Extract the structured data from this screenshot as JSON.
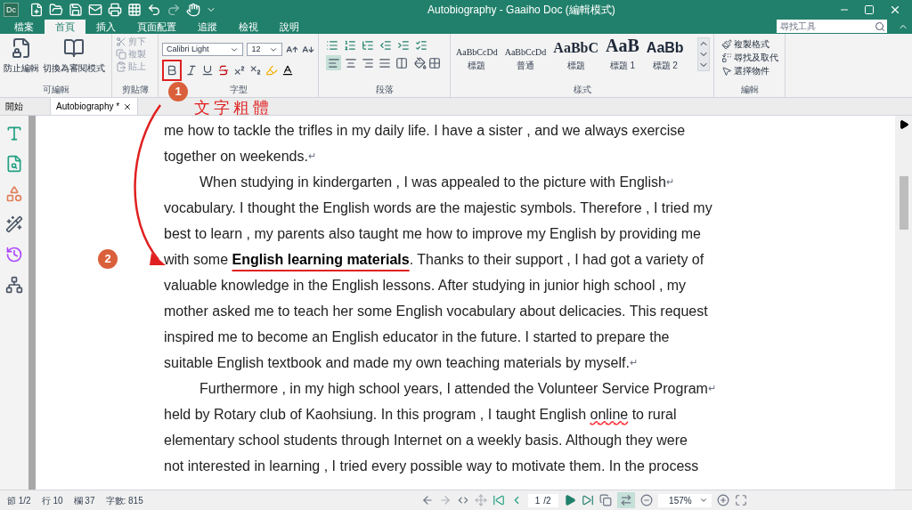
{
  "window": {
    "title": "Autobiography - Gaaiho Doc (編輯模式)",
    "logo": "Dc"
  },
  "search": {
    "placeholder": "尋找工具"
  },
  "menu_tabs": [
    {
      "label": "檔案",
      "selected": false
    },
    {
      "label": "首頁",
      "selected": true
    },
    {
      "label": "插入",
      "selected": false
    },
    {
      "label": "頁面配置",
      "selected": false
    },
    {
      "label": "追蹤",
      "selected": false
    },
    {
      "label": "檢視",
      "selected": false
    },
    {
      "label": "說明",
      "selected": false
    }
  ],
  "ribbon": {
    "protect": {
      "label": "可編輯",
      "buttons": [
        "防止編輯",
        "切換為審閱模式"
      ]
    },
    "clipboard": {
      "label": "剪貼簿",
      "items": [
        {
          "label": "剪下",
          "disabled": true
        },
        {
          "label": "複製",
          "disabled": true
        },
        {
          "label": "貼上",
          "disabled": true
        }
      ]
    },
    "font": {
      "label": "字型",
      "font_name": "Calibri Light",
      "font_size": "12",
      "bold_highlighted": true
    },
    "paragraph": {
      "label": "段落",
      "align": [
        {
          "kind": "left",
          "selected": true
        },
        {
          "kind": "center",
          "selected": false
        },
        {
          "kind": "right",
          "selected": false
        },
        {
          "kind": "justify",
          "selected": false
        },
        {
          "kind": "distributed",
          "selected": false
        }
      ]
    },
    "styles": {
      "label": "樣式",
      "items": [
        {
          "preview": "AaBbCcDd",
          "name": "標題"
        },
        {
          "preview": "AaBbCcDd",
          "name": "普通"
        },
        {
          "preview": "AaBbC",
          "name": "標題"
        },
        {
          "preview": "AaB",
          "name": "標題 1"
        },
        {
          "preview": "AaBb",
          "name": "標題 2"
        }
      ]
    },
    "editing": {
      "label": "編輯",
      "items": [
        "複製格式",
        "尋找及取代",
        "選擇物件"
      ]
    }
  },
  "doc_tabs": [
    {
      "label": "開始",
      "selected": false,
      "closable": false
    },
    {
      "label": "Autobiography *",
      "selected": true,
      "closable": true
    }
  ],
  "document": {
    "lines": [
      {
        "indent": false,
        "segments": [
          {
            "text": "me how to tackle the trifles in my daily life. I have a sister , and we always exercise"
          }
        ]
      },
      {
        "indent": false,
        "end_mark": "↵",
        "segments": [
          {
            "text": "together on weekends."
          }
        ]
      },
      {
        "indent": true,
        "end_mark": "↵",
        "segments": [
          {
            "text": "When studying in kindergarten , I was appealed to the picture with English"
          }
        ]
      },
      {
        "indent": false,
        "segments": [
          {
            "text": "vocabulary. I thought the English words are the majestic symbols. Therefore , I tried my"
          }
        ]
      },
      {
        "indent": false,
        "segments": [
          {
            "text": "best to learn , my parents also taught me how to improve my English by providing me"
          }
        ]
      },
      {
        "indent": false,
        "segments": [
          {
            "text": "with some "
          },
          {
            "text": "English learning materials",
            "kind": "bold"
          },
          {
            "text": ". Thanks to their support , I had got a variety of"
          }
        ]
      },
      {
        "indent": false,
        "segments": [
          {
            "text": "valuable knowledge in the English lessons. After studying in junior high school , my"
          }
        ]
      },
      {
        "indent": false,
        "segments": [
          {
            "text": "mother asked me to teach her some English vocabulary about delicacies. This request"
          }
        ]
      },
      {
        "indent": false,
        "segments": [
          {
            "text": "inspired me to become an English educator in the future. I started to prepare the"
          }
        ]
      },
      {
        "indent": false,
        "end_mark": "↵",
        "segments": [
          {
            "text": "suitable English textbook and made my own teaching materials by myself."
          }
        ]
      },
      {
        "indent": true,
        "end_mark": "↵",
        "segments": [
          {
            "text": "Furthermore , in my high school years, I attended the Volunteer Service Program"
          }
        ]
      },
      {
        "indent": false,
        "segments": [
          {
            "text": "held by Rotary club of Kaohsiung. In this program , I taught English "
          },
          {
            "text": "online",
            "kind": "misspelled"
          },
          {
            "text": " to rural"
          }
        ]
      },
      {
        "indent": false,
        "segments": [
          {
            "text": "elementary school students through Internet on a weekly basis. Although they were"
          }
        ]
      },
      {
        "indent": false,
        "segments": [
          {
            "text": "not interested in learning , I tried every possible way to motivate them. In the process"
          }
        ]
      }
    ]
  },
  "annotations": {
    "step_badges": [
      "1",
      "2"
    ],
    "note": "文字粗體"
  },
  "status_bar": {
    "items": [
      "節 1/2",
      "行 10",
      "欄 37",
      "字數: 815"
    ],
    "page": "1",
    "page_total": "/2",
    "zoom": "157%",
    "fit_width_selected": true
  }
}
